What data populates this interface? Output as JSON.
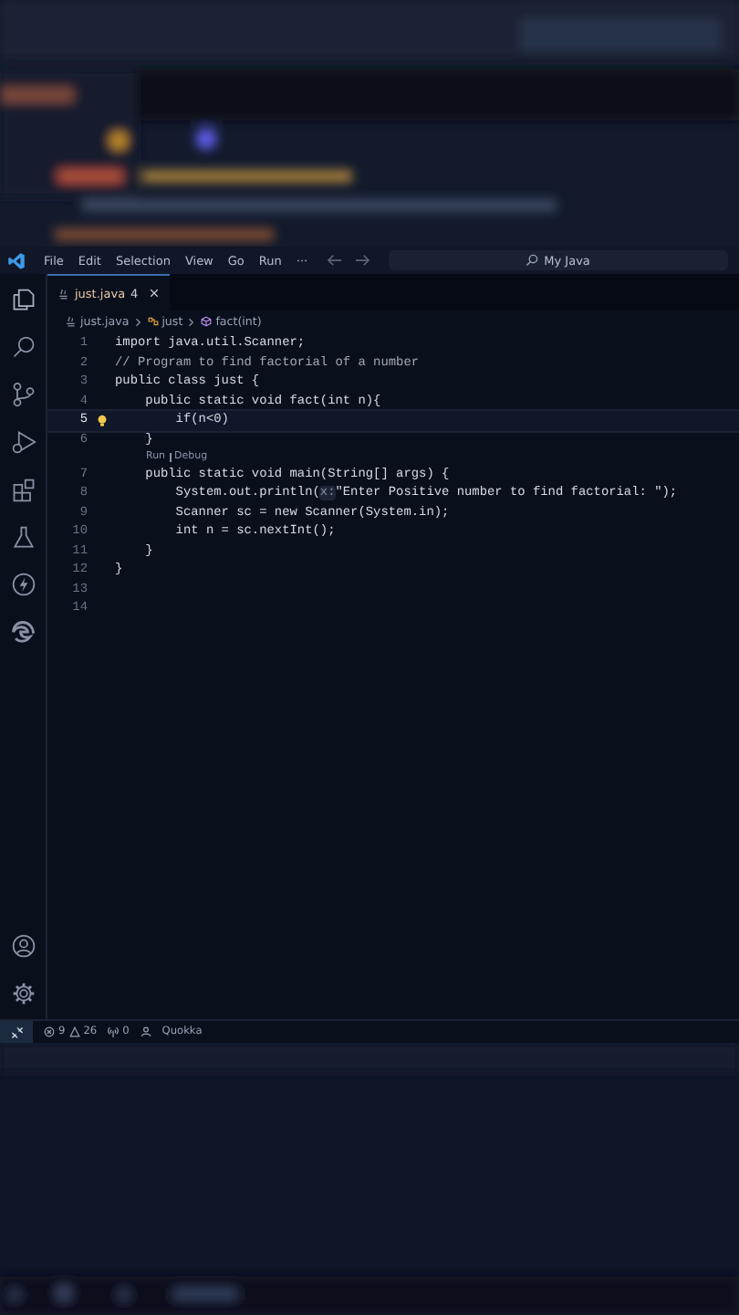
{
  "menu_bar": {
    "items": [
      "File",
      "Edit",
      "Selection",
      "View",
      "Go",
      "Run",
      "···"
    ],
    "search": {
      "value": "My Java"
    }
  },
  "tabs": [
    {
      "label": "just.java",
      "badge": "4",
      "selected": true
    }
  ],
  "breadcrumb": [
    "just.java",
    "just",
    "fact(int)"
  ],
  "editor": {
    "lines": [
      {
        "kind": "code",
        "number": "1",
        "current": false,
        "segments": [
          {
            "kind": "code",
            "text": "import java.util.Scanner;"
          }
        ]
      },
      {
        "kind": "code",
        "number": "2",
        "current": false,
        "segments": [
          {
            "kind": "comment",
            "text": "// Program to find factorial of a number"
          }
        ]
      },
      {
        "kind": "code",
        "number": "3",
        "current": false,
        "segments": [
          {
            "kind": "code",
            "text": "public class just {"
          }
        ]
      },
      {
        "kind": "code",
        "number": "4",
        "current": false,
        "segments": [
          {
            "kind": "code",
            "text": "    public static void fact(int n){"
          }
        ]
      },
      {
        "kind": "code",
        "number": "5",
        "current": true,
        "segments": [
          {
            "kind": "code",
            "text": "        if(n<0)"
          }
        ]
      },
      {
        "kind": "code",
        "number": "6",
        "current": false,
        "segments": [
          {
            "kind": "code",
            "text": "    }"
          }
        ]
      },
      {
        "kind": "codelens",
        "links": [
          "Run",
          "Debug"
        ]
      },
      {
        "kind": "code",
        "number": "7",
        "current": false,
        "segments": [
          {
            "kind": "code",
            "text": "    public static void main(String[] args) {"
          }
        ]
      },
      {
        "kind": "code",
        "number": "8",
        "current": false,
        "segments": [
          {
            "kind": "code",
            "text": "        System.out.println("
          },
          {
            "kind": "hint",
            "text": "x:"
          },
          {
            "kind": "code",
            "text": "\"Enter Positive number to find factorial: \");"
          }
        ]
      },
      {
        "kind": "code",
        "number": "9",
        "current": false,
        "segments": [
          {
            "kind": "code",
            "text": "        Scanner sc = new Scanner(System.in);"
          }
        ]
      },
      {
        "kind": "code",
        "number": "10",
        "current": false,
        "segments": [
          {
            "kind": "code",
            "text": "        int n = sc.nextInt();"
          }
        ]
      },
      {
        "kind": "code",
        "number": "11",
        "current": false,
        "segments": [
          {
            "kind": "code",
            "text": "    }"
          }
        ]
      },
      {
        "kind": "code",
        "number": "12",
        "current": false,
        "segments": [
          {
            "kind": "code",
            "text": "}"
          }
        ]
      },
      {
        "kind": "code",
        "number": "13",
        "current": false
      },
      {
        "kind": "code",
        "number": "14",
        "current": false
      }
    ]
  },
  "status_bar": {
    "errors": "9",
    "warnings": "26",
    "ports": "0",
    "extension": "Quokka"
  }
}
